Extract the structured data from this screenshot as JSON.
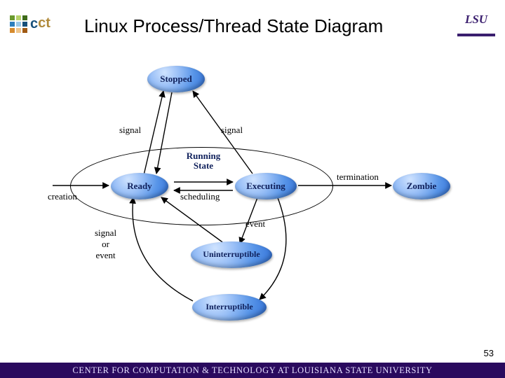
{
  "title": "Linux Process/Thread State Diagram",
  "page_number": "53",
  "footer": "CENTER FOR COMPUTATION & TECHNOLOGY AT LOUISIANA STATE UNIVERSITY",
  "logos": {
    "cct_text": "cct",
    "cct_ct": "ct",
    "lsu": "LSU"
  },
  "nodes": {
    "stopped": "Stopped",
    "ready": "Ready",
    "executing": "Executing",
    "zombie": "Zombie",
    "uninterruptible": "Uninterruptible",
    "interruptible": "Interruptible"
  },
  "running_state_title": "Running\nState",
  "edges": {
    "creation": "creation",
    "signal_left": "signal",
    "signal_right": "signal",
    "scheduling": "scheduling",
    "termination": "termination",
    "event": "event",
    "signal_or_event": "signal\nor\nevent"
  },
  "colors": {
    "footer_bg": "#2a0a5e",
    "node_text": "#10215c",
    "lsu_purple": "#3a1e6e"
  }
}
